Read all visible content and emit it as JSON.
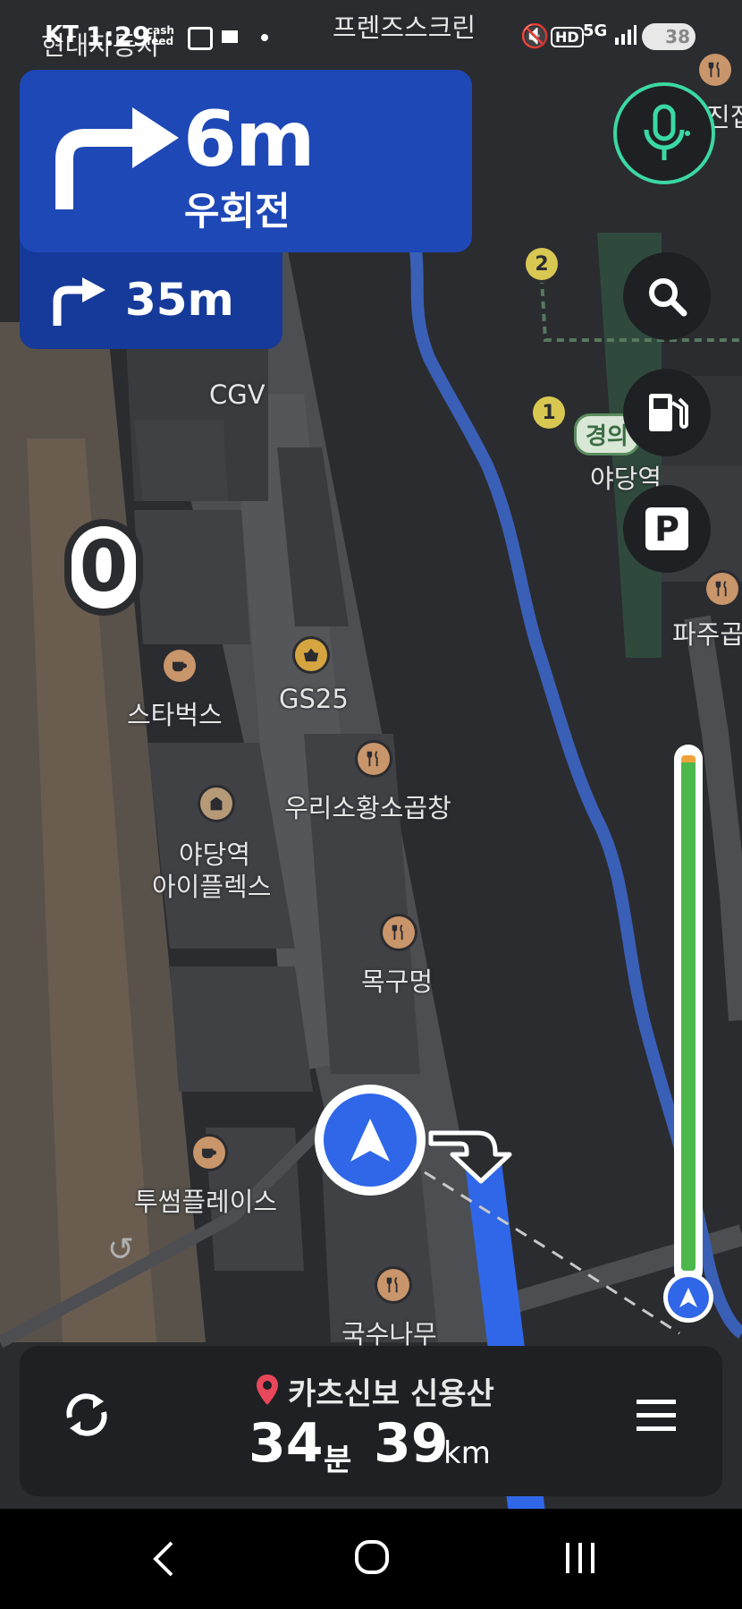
{
  "status_bar": {
    "carrier": "KT",
    "time": "1:29",
    "cash_label": "cash feed",
    "battery": "38"
  },
  "map": {
    "labels": {
      "top_partial_left": "현대자동차",
      "top_center": "프렌즈스크린",
      "cgv": "CGV",
      "station_sign": "경의",
      "station": "야당역",
      "paju": "파주곱",
      "jinjip": "진집",
      "starbucks": "스타벅스",
      "gs25": "GS25",
      "gopchang": "우리소황소곱창",
      "iplex_line1": "야당역",
      "iplex_line2": "아이플렉스",
      "mokgu": "목구멍",
      "twosome": "투썸플레이스",
      "guksu": "국수나무"
    },
    "markers": [
      "2",
      "1"
    ]
  },
  "turn_panel": {
    "distance": "6m",
    "direction": "우회전",
    "next_distance": "35m"
  },
  "speed": "0",
  "controls": {
    "mic": "mic-icon",
    "search": "search-icon",
    "fuel": "fuel-icon",
    "parking": "P"
  },
  "progress": {
    "fraction_remaining": 1.0,
    "accent": "#4cb84c"
  },
  "bottom": {
    "destination": "카츠신보 신용산",
    "eta_value": "34",
    "eta_unit": "분",
    "distance_value": "39",
    "distance_unit": "km"
  },
  "colors": {
    "turn_panel": "#1e48b6",
    "route": "#2f67e8",
    "mic_ring": "#3bd8a3"
  }
}
